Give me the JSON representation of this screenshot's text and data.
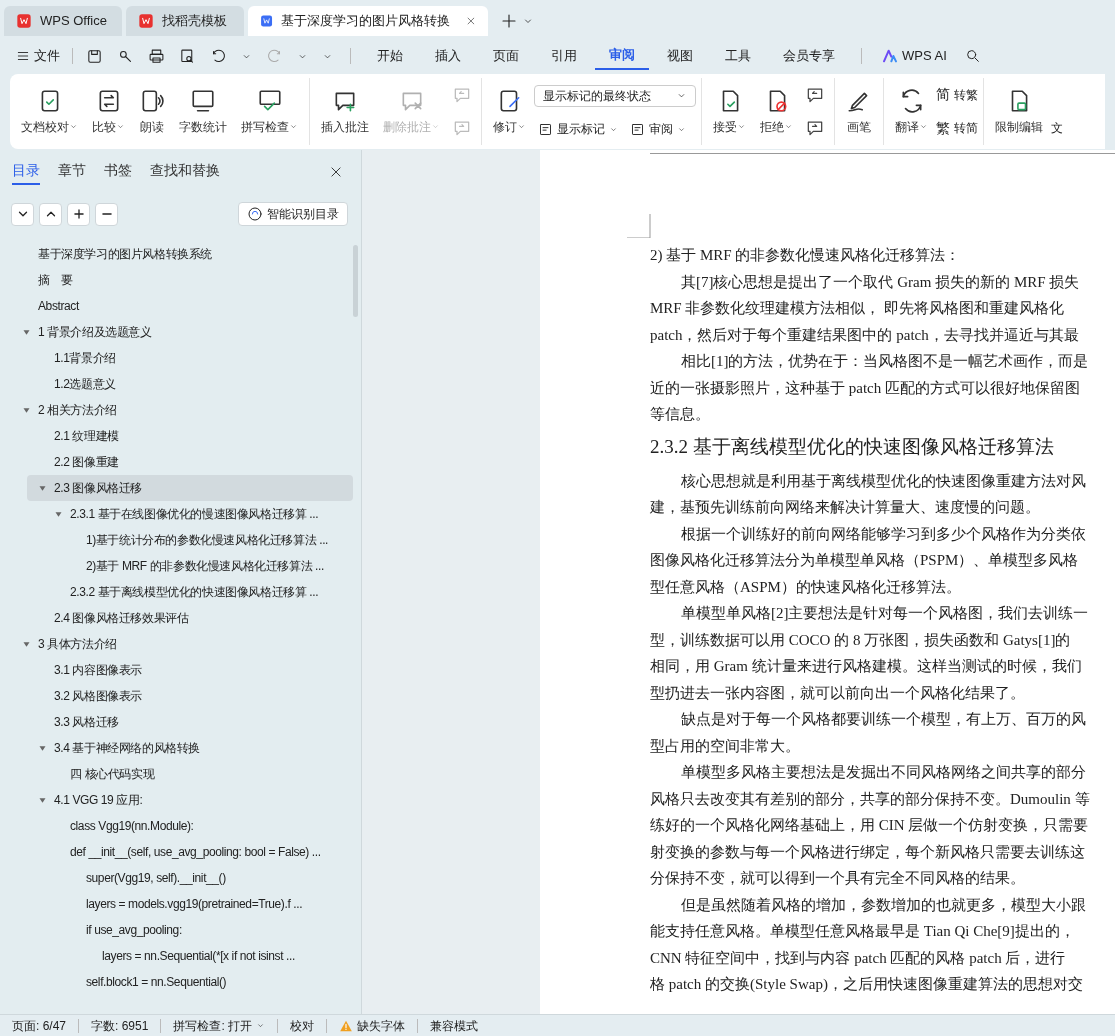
{
  "tabs": [
    {
      "label": "WPS Office",
      "selected": false
    },
    {
      "label": "找稻壳模板",
      "selected": false
    },
    {
      "label": "基于深度学习的图片风格转换",
      "selected": true
    }
  ],
  "menu": {
    "file": "文件",
    "items": [
      {
        "label": "开始",
        "selected": false
      },
      {
        "label": "插入",
        "selected": false
      },
      {
        "label": "页面",
        "selected": false
      },
      {
        "label": "引用",
        "selected": false
      },
      {
        "label": "审阅",
        "selected": true
      },
      {
        "label": "视图",
        "selected": false
      },
      {
        "label": "工具",
        "selected": false
      },
      {
        "label": "会员专享",
        "selected": false
      }
    ],
    "ai": "WPS AI"
  },
  "ribbon": [
    {
      "items": [
        {
          "kind": "big",
          "label": "文档校对",
          "dropdown": true,
          "disabled": false
        },
        {
          "kind": "big",
          "label": "比较",
          "dropdown": true,
          "disabled": false
        },
        {
          "kind": "big",
          "label": "朗读",
          "dropdown": false,
          "disabled": false
        },
        {
          "kind": "big",
          "label": "字数统计",
          "dropdown": false,
          "disabled": false
        },
        {
          "kind": "big",
          "label": "拼写检查",
          "dropdown": true,
          "disabled": false
        }
      ]
    },
    {
      "items": [
        {
          "kind": "big",
          "label": "插入批注",
          "dropdown": false,
          "disabled": false
        },
        {
          "kind": "big",
          "label": "删除批注",
          "dropdown": true,
          "disabled": true
        },
        {
          "kind": "pair",
          "disabled": true
        }
      ]
    },
    {
      "items": [
        {
          "kind": "big",
          "label": "修订",
          "dropdown": true,
          "disabled": false
        },
        {
          "kind": "markup",
          "select": "显示标记的最终状态",
          "buttons": [
            "显示标记",
            "审阅"
          ]
        }
      ]
    },
    {
      "items": [
        {
          "kind": "big",
          "label": "接受",
          "dropdown": true,
          "disabled": false
        },
        {
          "kind": "big",
          "label": "拒绝",
          "dropdown": true,
          "disabled": false
        },
        {
          "kind": "pair",
          "disabled": false
        }
      ]
    },
    {
      "items": [
        {
          "kind": "big",
          "label": "画笔",
          "dropdown": false,
          "disabled": false
        }
      ]
    },
    {
      "items": [
        {
          "kind": "big",
          "label": "翻译",
          "dropdown": true,
          "disabled": false
        },
        {
          "kind": "convert",
          "rows": [
            {
              "glyph": "简",
              "label": "转繁"
            },
            {
              "glyph": "繁",
              "label": "转简"
            }
          ]
        }
      ]
    },
    {
      "items": [
        {
          "kind": "big",
          "label": "限制编辑",
          "dropdown": false,
          "disabled": false
        },
        {
          "kind": "cut",
          "label": "文"
        }
      ]
    }
  ],
  "sidebar": {
    "tabs": [
      {
        "label": "目录",
        "selected": true
      },
      {
        "label": "章节",
        "selected": false
      },
      {
        "label": "书签",
        "selected": false
      },
      {
        "label": "查找和替换",
        "selected": false
      }
    ],
    "smart_button": "智能识别目录",
    "outline": [
      {
        "label": "基于深度学习的图片风格转换系统",
        "selected": false
      },
      {
        "label": "摘　要",
        "selected": false
      },
      {
        "label": "Abstract",
        "selected": false
      },
      {
        "label": "1  背景介绍及选题意义",
        "selected": false,
        "expanded": true,
        "children": [
          {
            "label": "1.1背景介绍",
            "selected": false
          },
          {
            "label": "1.2选题意义",
            "selected": false
          }
        ]
      },
      {
        "label": "2  相关方法介绍",
        "selected": false,
        "expanded": true,
        "children": [
          {
            "label": "2.1  纹理建模",
            "selected": false
          },
          {
            "label": "2.2  图像重建",
            "selected": false
          },
          {
            "label": "2.3  图像风格迁移",
            "selected": true,
            "expanded": true,
            "children": [
              {
                "label": "2.3.1  基于在线图像优化的慢速图像风格迁移算 ...",
                "selected": false,
                "expanded": true,
                "children": [
                  {
                    "label": "1)基于统计分布的参数化慢速风格化迁移算法 ...",
                    "selected": false
                  },
                  {
                    "label": "2)基于  MRF  的非参数化慢速风格化迁移算法 ...",
                    "selected": false
                  }
                ]
              },
              {
                "label": "2.3.2  基于离线模型优化的快速图像风格迁移算 ...",
                "selected": false
              }
            ]
          },
          {
            "label": "2.4  图像风格迁移效果评估",
            "selected": false
          }
        ]
      },
      {
        "label": "3  具体方法介绍",
        "selected": false,
        "expanded": true,
        "children": [
          {
            "label": "3.1  内容图像表示",
            "selected": false
          },
          {
            "label": "3.2  风格图像表示",
            "selected": false
          },
          {
            "label": "3.3  风格迁移",
            "selected": false
          },
          {
            "label": "3.4  基于神经网络的风格转换",
            "selected": false,
            "expanded": true,
            "children": [
              {
                "label": "四  核心代码实现",
                "selected": false
              }
            ]
          },
          {
            "label": "4.1 VGG 19 应用:",
            "selected": false,
            "expanded": true,
            "children": [
              {
                "label": "class Vgg19(nn.Module):",
                "selected": false
              },
              {
                "label": "def __init__(self, use_avg_pooling: bool = False) ...",
                "selected": false,
                "children": [
                  {
                    "label": "super(Vgg19, self).__init__()",
                    "selected": false
                  },
                  {
                    "label": "layers = models.vgg19(pretrained=True).f ...",
                    "selected": false
                  },
                  {
                    "label": "if use_avg_pooling:",
                    "selected": false,
                    "children": [
                      {
                        "label": "layers = nn.Sequential(*[x if not isinst ...",
                        "selected": false
                      }
                    ]
                  },
                  {
                    "label": "self.block1 = nn.Sequential()",
                    "selected": false
                  }
                ]
              }
            ]
          }
        ]
      }
    ]
  },
  "document": {
    "lines": [
      {
        "kind": "line",
        "text": "2) 基于 MRF 的非参数化慢速风格化迁移算法："
      },
      {
        "kind": "indent",
        "text": "其[7]核心思想是提出了一个取代 Gram 损失的新的 MRF 损失"
      },
      {
        "kind": "line",
        "text": "MRF 非参数化纹理建模方法相似， 即先将风格图和重建风格化"
      },
      {
        "kind": "line",
        "text": "patch，然后对于每个重建结果图中的 patch，去寻找并逼近与其最"
      },
      {
        "kind": "indent",
        "text": "相比[1]的方法，优势在于：当风格图不是一幅艺术画作，而是"
      },
      {
        "kind": "line",
        "text": "近的一张摄影照片，这种基于 patch 匹配的方式可以很好地保留图"
      },
      {
        "kind": "line",
        "text": "等信息。"
      },
      {
        "kind": "heading",
        "text": "2.3.2  基于离线模型优化的快速图像风格迁移算法"
      },
      {
        "kind": "indent",
        "text": "核心思想就是利用基于离线模型优化的快速图像重建方法对风"
      },
      {
        "kind": "line",
        "text": "建，基预先训练前向网络来解决计算量大、速度慢的问题。"
      },
      {
        "kind": "indent",
        "text": "根据一个训练好的前向网络能够学习到多少个风格作为分类依"
      },
      {
        "kind": "line",
        "text": "图像风格化迁移算法分为单模型单风格（PSPM）、单模型多风格"
      },
      {
        "kind": "line",
        "text": "型任意风格（ASPM）的快速风格化迁移算法。"
      },
      {
        "kind": "indent",
        "text": "单模型单风格[2]主要想法是针对每一个风格图，我们去训练一"
      },
      {
        "kind": "line",
        "text": "型，训练数据可以用 COCO 的 8 万张图，损失函数和 Gatys[1]的"
      },
      {
        "kind": "line",
        "text": "相同，用 Gram 统计量来进行风格建模。这样当测试的时候，我们"
      },
      {
        "kind": "line",
        "text": "型扔进去一张内容图，就可以前向出一个风格化结果了。"
      },
      {
        "kind": "indent",
        "text": "缺点是对于每一个风格都要训练一个模型，有上万、百万的风"
      },
      {
        "kind": "line",
        "text": "型占用的空间非常大。"
      },
      {
        "kind": "indent",
        "text": "单模型多风格主要想法是发掘出不同风格网络之间共享的部分"
      },
      {
        "kind": "line",
        "text": "风格只去改变其有差别的部分，共享的部分保持不变。Dumoulin 等"
      },
      {
        "kind": "line",
        "text": "练好的一个风格化网络基础上，用 CIN 层做一个仿射变换，只需要"
      },
      {
        "kind": "line",
        "text": "射变换的参数与每一个风格进行绑定，每个新风格只需要去训练这"
      },
      {
        "kind": "line",
        "text": "分保持不变，就可以得到一个具有完全不同风格的结果。"
      },
      {
        "kind": "indent",
        "text": "但是虽然随着风格的增加，参数增加的也就更多，模型大小跟"
      },
      {
        "kind": "line",
        "text": "能支持任意风格。单模型任意风格最早是 Tian Qi Che[9]提出的，"
      },
      {
        "kind": "line",
        "text": "CNN 特征空间中，找到与内容 patch 匹配的风格 patch 后，进行"
      },
      {
        "kind": "line",
        "text": "格 patch 的交换(Style Swap)，之后用快速图像重建算法的思想对交"
      }
    ]
  },
  "status_bar": [
    {
      "kind": "text",
      "label": "页面: 6/47"
    },
    {
      "kind": "text",
      "label": "字数: 6951"
    },
    {
      "kind": "dropdown",
      "label": "拼写检查: 打开"
    },
    {
      "kind": "text",
      "label": "校对"
    },
    {
      "kind": "warning",
      "label": "缺失字体"
    },
    {
      "kind": "text",
      "label": "兼容模式"
    }
  ]
}
